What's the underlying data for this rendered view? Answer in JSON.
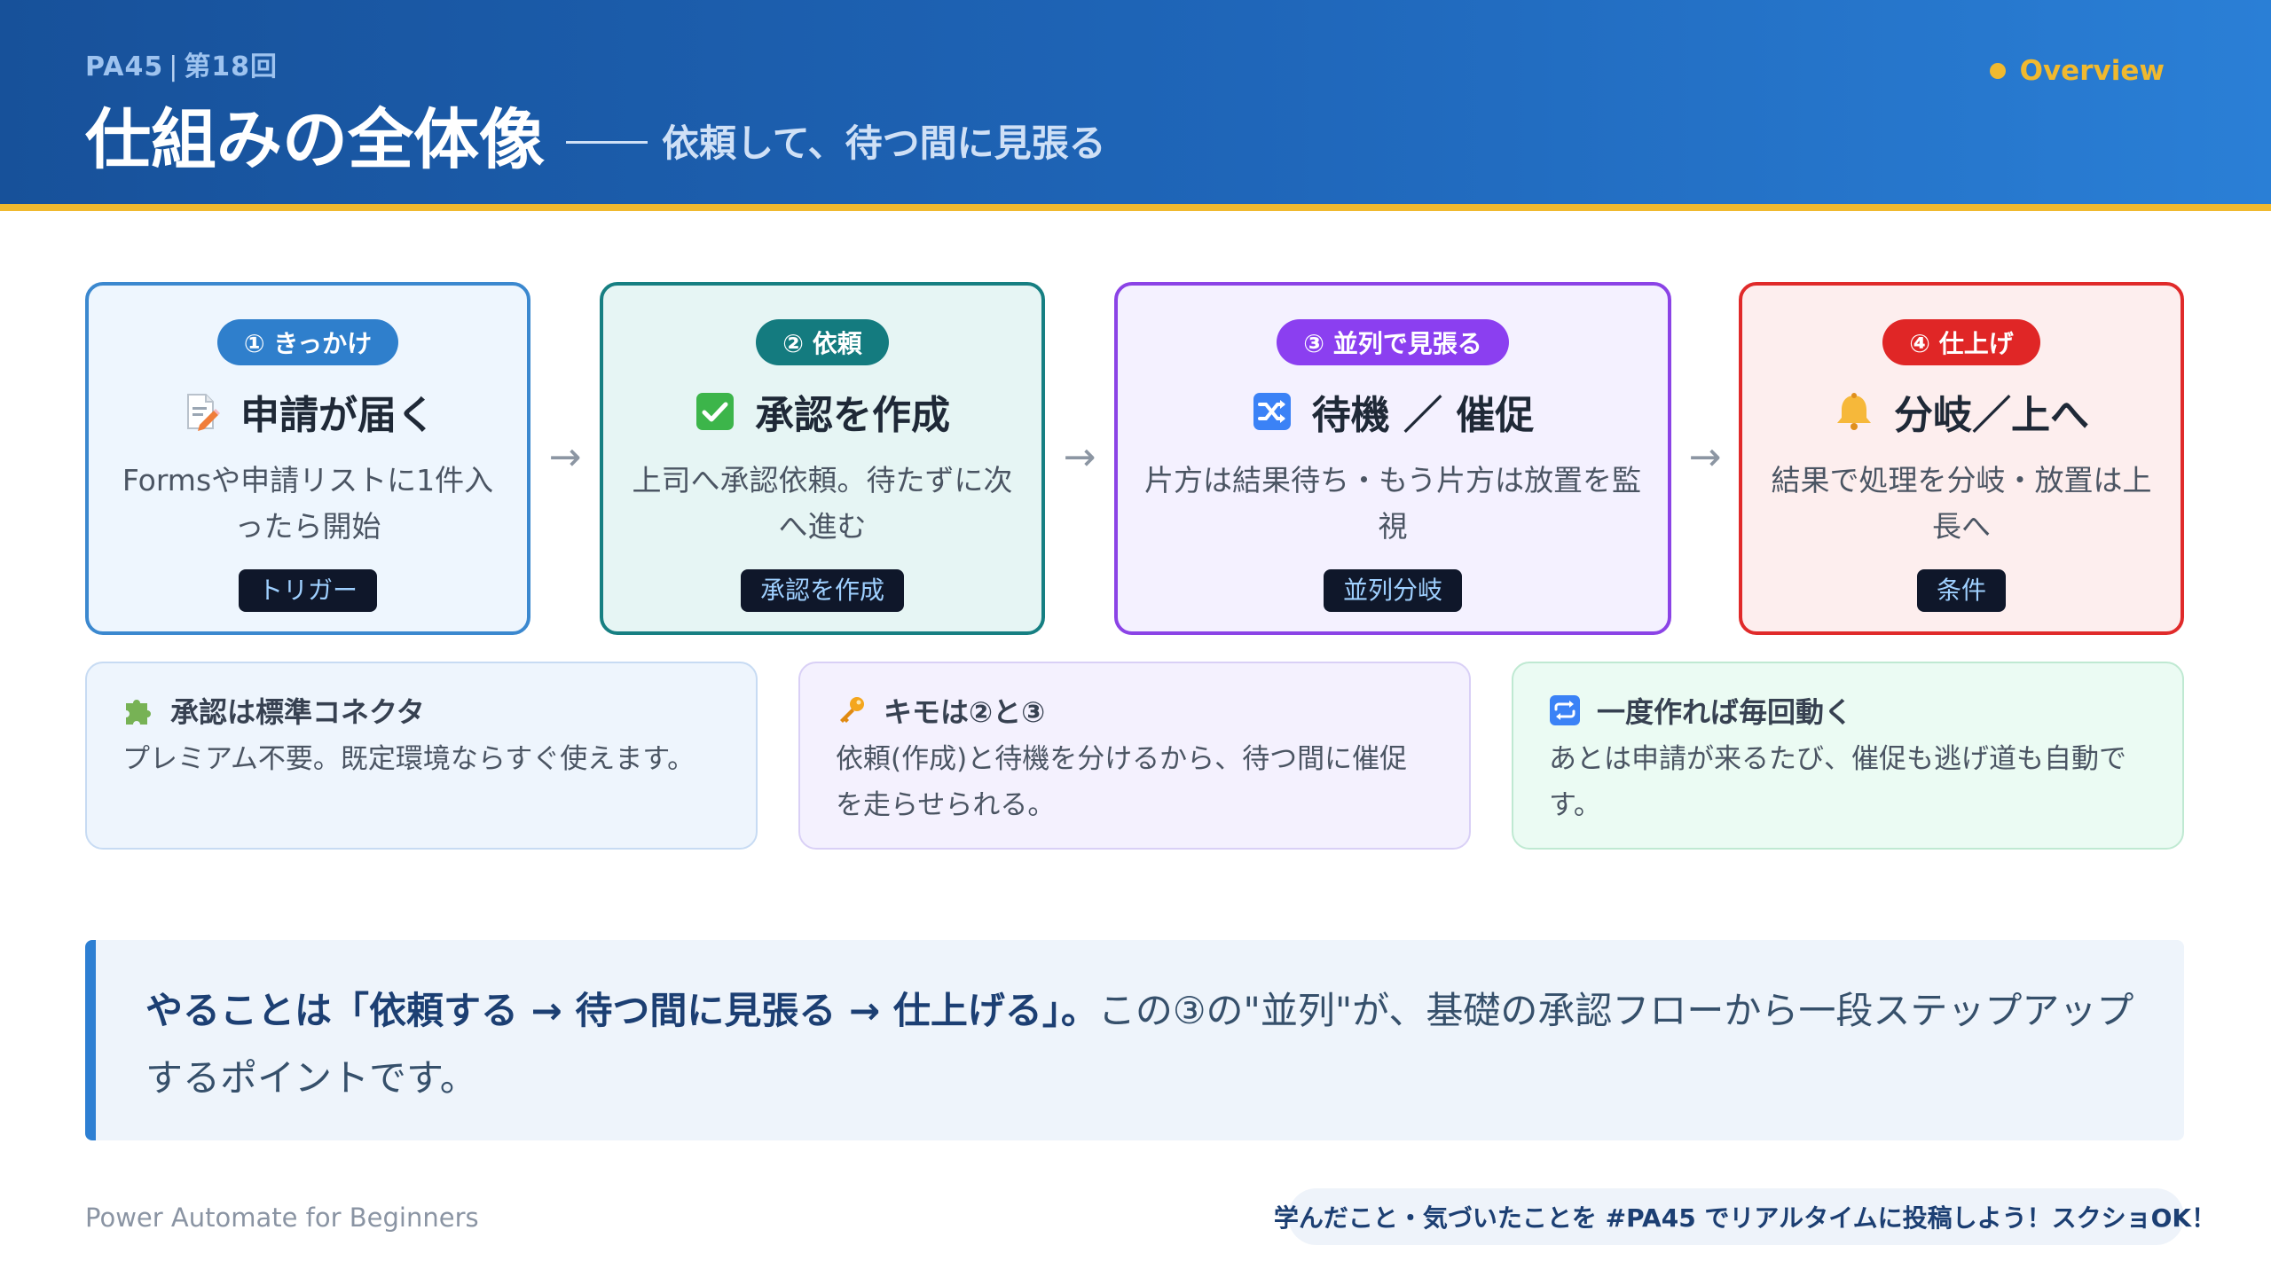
{
  "header": {
    "kicker_series": "PA45",
    "kicker_episode": "第18回",
    "title": "仕組みの全体像",
    "subtitle": "依頼して、待つ間に見張る",
    "overview_label": "Overview"
  },
  "steps": [
    {
      "badge": "① きっかけ",
      "heading": "申請が届く",
      "icon": "memo-icon",
      "desc": "Formsや申請リストに1件入ったら開始",
      "tag": "トリガー",
      "accent": "#3b88cf"
    },
    {
      "badge": "② 依頼",
      "heading": "承認を作成",
      "icon": "check-box-icon",
      "desc": "上司へ承認依頼。待たずに次へ進む",
      "tag": "承認を作成",
      "accent": "#167f82"
    },
    {
      "badge": "③ 並列で見張る",
      "heading": "待機 ／ 催促",
      "icon": "shuffle-icon",
      "desc": "片方は結果待ち・もう片方は放置を監視",
      "tag": "並列分岐",
      "accent": "#8b43e6"
    },
    {
      "badge": "④ 仕上げ",
      "heading": "分岐／上へ",
      "icon": "bell-icon",
      "desc": "結果で処理を分岐・放置は上長へ",
      "tag": "条件",
      "accent": "#e02a2a"
    }
  ],
  "arrows": [
    "→",
    "→",
    "→"
  ],
  "infos": [
    {
      "title": "承認は標準コネクタ",
      "icon": "puzzle-icon",
      "text": "プレミアム不要。既定環境ならすぐ使えます。"
    },
    {
      "title": "キモは②と③",
      "icon": "key-icon",
      "text": "依頼(作成)と待機を分けるから、待つ間に催促を走らせられる。"
    },
    {
      "title": "一度作れば毎回動く",
      "icon": "repeat-icon",
      "text": "あとは申請が来るたび、催促も逃げ道も自動です。"
    }
  ],
  "callout": {
    "strong": "やることは「依頼する → 待つ間に見張る → 仕上げる」。",
    "rest": "この③の\"並列\"が、基礎の承認フローから一段ステップアップするポイントです。"
  },
  "footer": {
    "left": "Power Automate for Beginners",
    "pill": "学んだこと・気づいたことを #PA45 でリアルタイムに投稿しよう！スクショOK！"
  },
  "colors": {
    "header_start": "#17519a",
    "header_end": "#2a7fd6",
    "accent_yellow": "#f0b92f",
    "callout_bar": "#2d7fd3"
  }
}
